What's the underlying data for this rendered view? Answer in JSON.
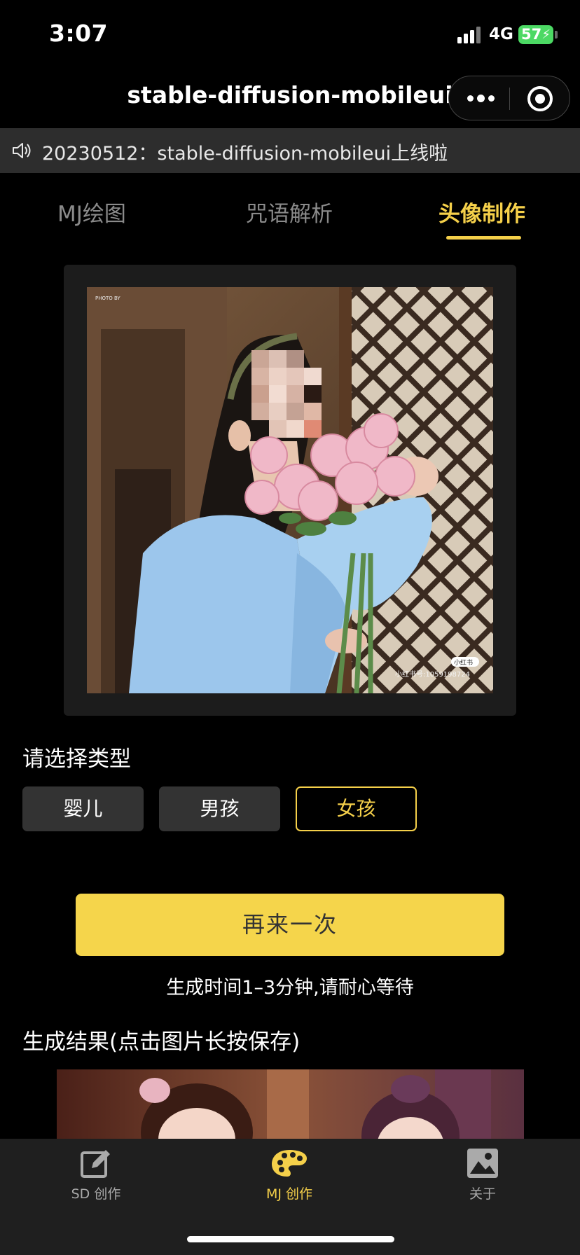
{
  "status_bar": {
    "time": "3:07",
    "network": "4G",
    "battery": "57"
  },
  "header": {
    "title": "stable-diffusion-mobileui"
  },
  "notice": {
    "text": "20230512：stable-diffusion-mobileui上线啦"
  },
  "tabs": [
    {
      "label": "MJ绘图",
      "active": false
    },
    {
      "label": "咒语解析",
      "active": false
    },
    {
      "label": "头像制作",
      "active": true
    }
  ],
  "photo": {
    "watermark_top": "PHOTO BY",
    "watermark_badge": "小红书",
    "watermark_id": "小红书号:1059198724"
  },
  "type_select": {
    "label": "请选择类型",
    "options": [
      {
        "label": "婴儿",
        "selected": false
      },
      {
        "label": "男孩",
        "selected": false
      },
      {
        "label": "女孩",
        "selected": true
      }
    ]
  },
  "action": {
    "retry_label": "再来一次",
    "hint": "生成时间1–3分钟,请耐心等待"
  },
  "result": {
    "label": "生成结果(点击图片长按保存)"
  },
  "tabbar": [
    {
      "label": "SD 创作",
      "icon": "edit-icon",
      "active": false
    },
    {
      "label": "MJ 创作",
      "icon": "palette-icon",
      "active": true
    },
    {
      "label": "关于",
      "icon": "image-icon",
      "active": false
    }
  ],
  "colors": {
    "accent": "#f5d04a",
    "button": "#f5d54b",
    "background": "#000000",
    "notice_bg": "#2d2d2d"
  }
}
